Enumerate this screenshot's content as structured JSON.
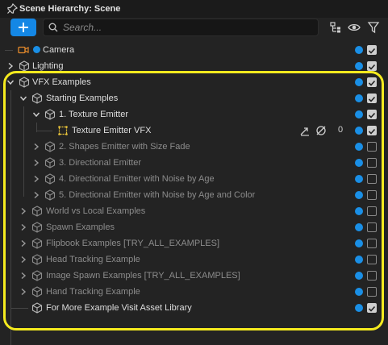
{
  "window": {
    "title": "Scene Hierarchy: Scene"
  },
  "toolbar": {
    "search_placeholder": "Search..."
  },
  "rows": [
    {
      "label": "Camera",
      "icon": "camera-icon",
      "dot": true,
      "checked": true
    },
    {
      "label": "Lighting",
      "icon": "object-icon",
      "checked": true
    },
    {
      "label": "VFX Examples",
      "icon": "object-icon",
      "checked": true
    },
    {
      "label": "Starting Examples",
      "icon": "object-icon",
      "checked": true
    },
    {
      "label": "1. Texture Emitter",
      "icon": "object-icon",
      "checked": true
    },
    {
      "label": "Texture Emitter VFX",
      "icon": "vfx-icon",
      "count": "0",
      "checked": true
    },
    {
      "label": "2. Shapes Emitter with Size Fade",
      "icon": "object-icon",
      "checked": false
    },
    {
      "label": "3. Directional Emitter",
      "icon": "object-icon",
      "checked": false
    },
    {
      "label": "4. Directional Emitter with Noise by Age",
      "icon": "object-icon",
      "checked": false
    },
    {
      "label": "5. Directional Emitter with Noise by Age and Color",
      "icon": "object-icon",
      "checked": false
    },
    {
      "label": "World vs Local Examples",
      "icon": "object-icon",
      "checked": false
    },
    {
      "label": "Spawn Examples",
      "icon": "object-icon",
      "checked": false
    },
    {
      "label": "Flipbook Examples [TRY_ALL_EXAMPLES]",
      "icon": "object-icon",
      "checked": false
    },
    {
      "label": "Head Tracking Example",
      "icon": "object-icon",
      "checked": false
    },
    {
      "label": "Image Spawn Examples [TRY_ALL_EXAMPLES]",
      "icon": "object-icon",
      "checked": false
    },
    {
      "label": "Hand Tracking Example",
      "icon": "object-icon",
      "checked": false
    },
    {
      "label": "For More Example Visit Asset Library",
      "icon": "object-icon",
      "checked": true
    }
  ],
  "colors": {
    "accent": "#1487e5",
    "highlight": "#f4ea1e",
    "camera": "#e58a2b",
    "vfx": "#e8c33a"
  }
}
